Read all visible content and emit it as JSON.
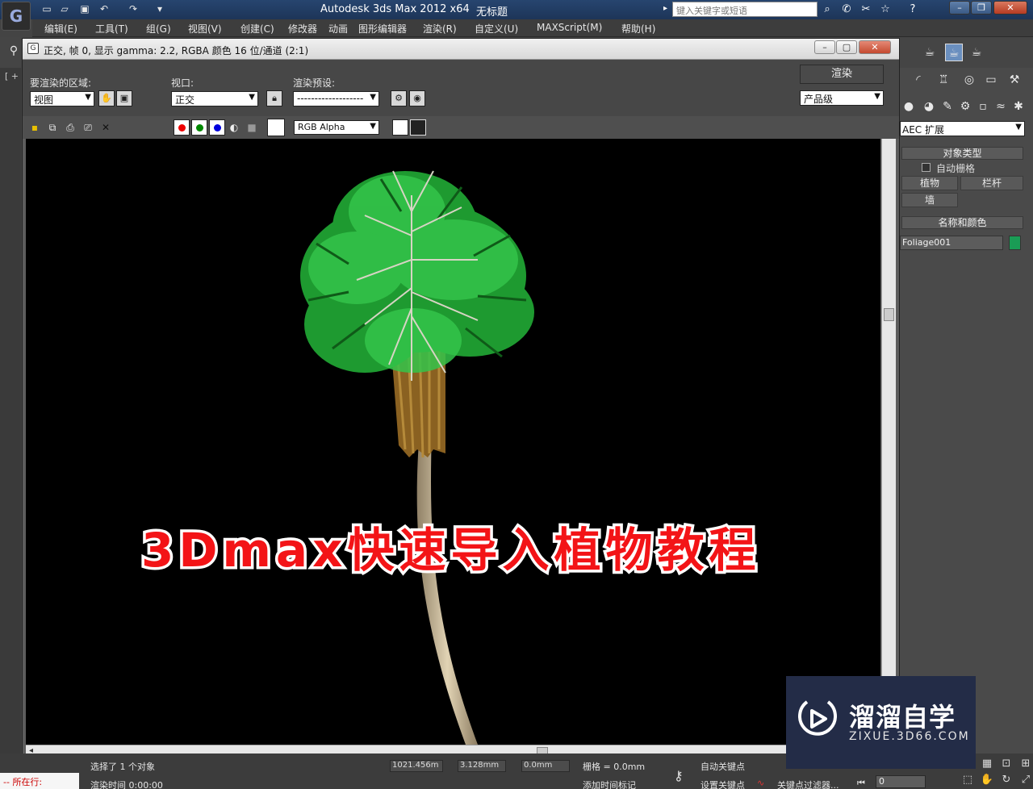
{
  "app": {
    "title": "Autodesk 3ds Max  2012 x64",
    "document": "无标题",
    "search_placeholder": "键入关键字或短语",
    "logo_text": "G"
  },
  "menu": [
    "编辑(E)",
    "工具(T)",
    "组(G)",
    "视图(V)",
    "创建(C)",
    "修改器",
    "动画",
    "图形编辑器",
    "渲染(R)",
    "自定义(U)",
    "MAXScript(M)",
    "帮助(H)"
  ],
  "viewport_label": "[ +",
  "render_window": {
    "title": "正交, 帧 0, 显示 gamma: 2.2, RGBA 颜色 16 位/通道 (2:1)",
    "area_label": "要渲染的区域:",
    "area_value": "视图",
    "viewport_label": "视口:",
    "viewport_value": "正交",
    "preset_label": "渲染预设:",
    "preset_value": "-------------------",
    "render_button": "渲染",
    "quality_value": "产品级",
    "channel_value": "RGB Alpha"
  },
  "overlay_title": "3Dmax快速导入植物教程",
  "command_panel": {
    "category_dropdown": "AEC 扩展",
    "object_type_header": "对象类型",
    "autogrid_label": "自动栅格",
    "buttons": [
      "植物",
      "栏杆",
      "墙"
    ],
    "name_color_header": "名称和颜色",
    "object_name": "Foliage001",
    "object_color": "#1a9c55"
  },
  "status": {
    "selection_text": "选择了 1 个对象",
    "render_time": "渲染时间  0:00:00",
    "x_value": "1021.456m",
    "y_value": "3.128mm",
    "z_value": "0.0mm",
    "grid_value": "栅格 = 0.0mm",
    "auto_key": "自动关键点",
    "set_key": "设置关键点",
    "key_filter": "关键点过滤器...",
    "add_time_tag": "添加时间标记",
    "frame": "0",
    "mini_listener": "所在行:"
  },
  "watermark": {
    "title": "溜溜自学",
    "url": "ZIXUE.3D66.COM"
  }
}
